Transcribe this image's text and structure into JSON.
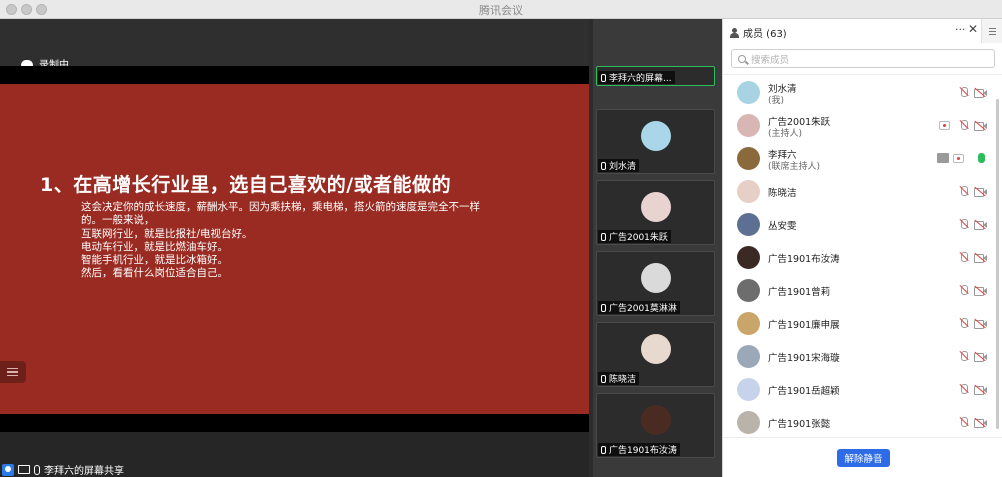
{
  "window": {
    "title": "腾讯会议"
  },
  "stage": {
    "recording_label": "录制中",
    "sharer_label": "李拜六的屏幕共享",
    "slide": {
      "title": "1、在高增长行业里，选自己喜欢的/或者能做的",
      "lines": [
        "这会决定你的成长速度，薪酬水平。因为乘扶梯，乘电梯，搭火箭的速度是完全不一样",
        "的。一般来说，",
        "互联网行业，就是比报社/电视台好。",
        "电动车行业，就是比燃油车好。",
        "智能手机行业，就是比冰箱好。",
        "然后，看看什么岗位适合自己。"
      ]
    }
  },
  "strip": {
    "tiles": [
      {
        "label": "李拜六的屏幕...",
        "avatar_color": "#3a3a3a"
      },
      {
        "label": "刘水清",
        "avatar_color": "#a9d6e8"
      },
      {
        "label": "广告2001朱跃",
        "avatar_color": "#e9d3d1"
      },
      {
        "label": "广告2001莫淋淋",
        "avatar_color": "#dadada"
      },
      {
        "label": "陈晓洁",
        "avatar_color": "#e8d9cf"
      },
      {
        "label": "广告1901布汝涛",
        "avatar_color": "#4a2b22"
      }
    ]
  },
  "panel": {
    "title": "成员 (63)",
    "more": "···",
    "close": "✕",
    "search_placeholder": "搜索成员",
    "unmute_label": "解除静音",
    "members": [
      {
        "name": "刘水清",
        "role": "(我)",
        "avatar_color": "#a8d3e3",
        "mic": "off",
        "rec": false,
        "share": false
      },
      {
        "name": "广告2001朱跃",
        "role": "(主持人)",
        "avatar_color": "#d8b6b3",
        "mic": "off",
        "rec": true,
        "share": false
      },
      {
        "name": "李拜六",
        "role": "(联席主持人)",
        "avatar_color": "#8a6a3a",
        "mic": "on",
        "rec": true,
        "share": true
      },
      {
        "name": "陈晓洁",
        "role": "",
        "avatar_color": "#e6cfc6",
        "mic": "off",
        "rec": false,
        "share": false
      },
      {
        "name": "丛安雯",
        "role": "",
        "avatar_color": "#5e6f94",
        "mic": "off",
        "rec": false,
        "share": false
      },
      {
        "name": "广告1901布汝涛",
        "role": "",
        "avatar_color": "#3b2a24",
        "mic": "off",
        "rec": false,
        "share": false
      },
      {
        "name": "广告1901曾莉",
        "role": "",
        "avatar_color": "#6d6d6d",
        "mic": "off",
        "rec": false,
        "share": false
      },
      {
        "name": "广告1901廉申展",
        "role": "",
        "avatar_color": "#c9a56a",
        "mic": "off",
        "rec": false,
        "share": false
      },
      {
        "name": "广告1901宋海璇",
        "role": "",
        "avatar_color": "#9aa8b8",
        "mic": "off",
        "rec": false,
        "share": false
      },
      {
        "name": "广告1901岳超颖",
        "role": "",
        "avatar_color": "#c7d3ea",
        "mic": "off",
        "rec": false,
        "share": false
      },
      {
        "name": "广告1901张懿",
        "role": "",
        "avatar_color": "#b9b3a9",
        "mic": "off",
        "rec": false,
        "share": false
      }
    ]
  }
}
